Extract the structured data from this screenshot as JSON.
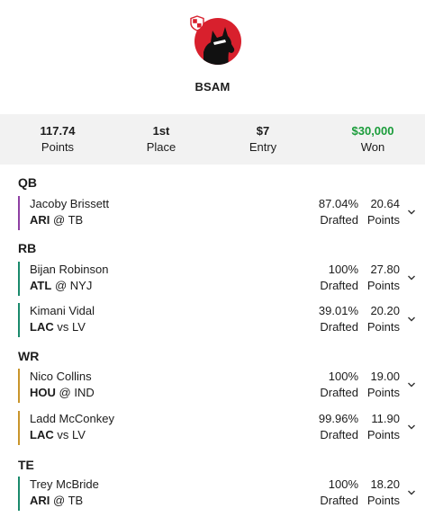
{
  "user": {
    "name": "BSAM",
    "avatar": "dog-avatar-icon",
    "badge": "shield-icon"
  },
  "stats": [
    {
      "value": "117.74",
      "label": "Points"
    },
    {
      "value": "1st",
      "label": "Place"
    },
    {
      "value": "$7",
      "label": "Entry"
    },
    {
      "value": "$30,000",
      "label": "Won"
    }
  ],
  "sections": [
    {
      "title": "QB"
    },
    {
      "title": "RB"
    },
    {
      "title": "WR"
    },
    {
      "title": "TE"
    }
  ],
  "players": [
    {
      "name": "Jacoby Brissett",
      "team": "ARI",
      "sep": "@",
      "opp": "TB",
      "drafted_pct": "87.04%",
      "drafted_label": "Drafted",
      "points": "20.64",
      "points_label": "Points",
      "color": "#8e3fa3"
    },
    {
      "name": "Bijan Robinson",
      "team": "ATL",
      "sep": "@",
      "opp": "NYJ",
      "drafted_pct": "100%",
      "drafted_label": "Drafted",
      "points": "27.80",
      "points_label": "Points",
      "color": "#1a8a6c"
    },
    {
      "name": "Kimani Vidal",
      "team": "LAC",
      "sep": "vs",
      "opp": "LV",
      "drafted_pct": "39.01%",
      "drafted_label": "Drafted",
      "points": "20.20",
      "points_label": "Points",
      "color": "#1a8a6c"
    },
    {
      "name": "Nico Collins",
      "team": "HOU",
      "sep": "@",
      "opp": "IND",
      "drafted_pct": "100%",
      "drafted_label": "Drafted",
      "points": "19.00",
      "points_label": "Points",
      "color": "#c9952b"
    },
    {
      "name": "Ladd McConkey",
      "team": "LAC",
      "sep": "vs",
      "opp": "LV",
      "drafted_pct": "99.96%",
      "drafted_label": "Drafted",
      "points": "11.90",
      "points_label": "Points",
      "color": "#c9952b"
    },
    {
      "name": "Trey McBride",
      "team": "ARI",
      "sep": "@",
      "opp": "TB",
      "drafted_pct": "100%",
      "drafted_label": "Drafted",
      "points": "18.20",
      "points_label": "Points",
      "color": "#1a8a6c"
    }
  ],
  "colors": {
    "accent_red": "#d8202d",
    "won_green": "#1a9c3a",
    "stats_bg": "#f2f2f2"
  }
}
